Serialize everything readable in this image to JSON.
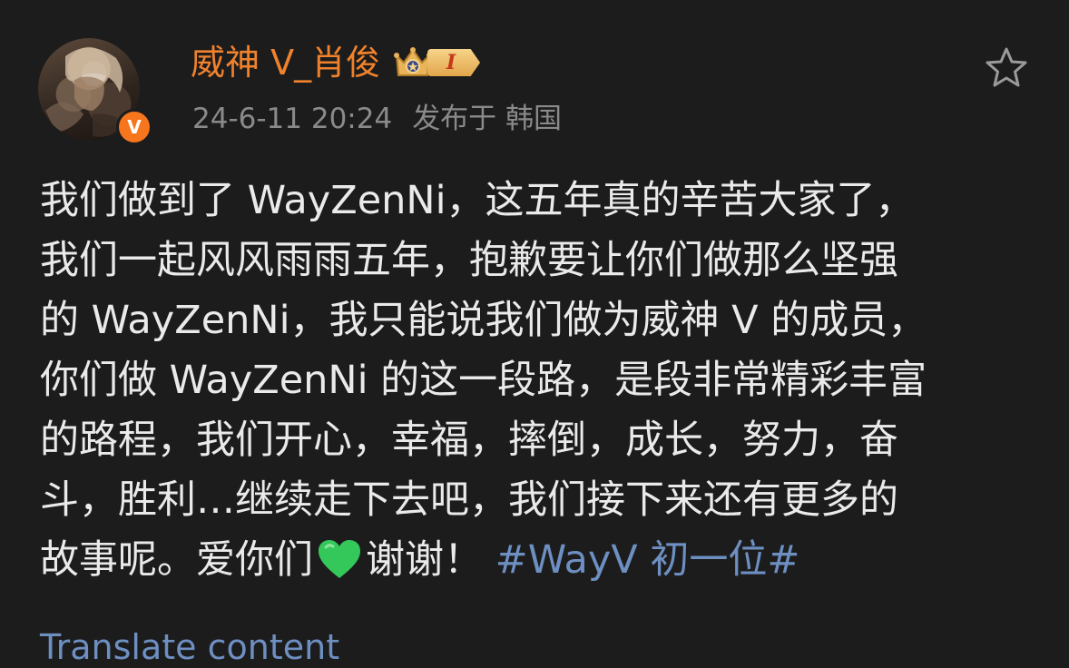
{
  "post": {
    "author": {
      "name": "威神 V_肖俊",
      "verified_badge": "V",
      "vip_level": "I",
      "avatar": "profile-photo"
    },
    "meta": {
      "timestamp": "24-6-11 20:24",
      "source": "发布于 韩国"
    },
    "favorite_icon": "star-outline-icon",
    "content": {
      "lines": [
        "我们做到了 WayZenNi，这五年真的辛苦大家了，",
        "我们一起风风雨雨五年，抱歉要让你们做那么坚强",
        "的 WayZenNi，我只能说我们做为威神 V 的成员，",
        "你们做 WayZenNi 的这一段路，是段非常精彩丰富",
        "的路程，我们开心，幸福，摔倒，成长，努力，奋",
        "斗，胜利…继续走下去吧，我们接下来还有更多的"
      ],
      "last_line_prefix": "故事呢。爱你们",
      "emoji": "green-heart-icon",
      "last_line_suffix": "谢谢！",
      "topic": "#WayV 初一位#"
    },
    "translate_label": "Translate content"
  },
  "colors": {
    "background": "#1c1c1c",
    "username": "#f0822d",
    "meta": "#8a8a8a",
    "body_text": "#eaeaea",
    "link": "#6d8fc2",
    "verified_badge": "#f7751c",
    "heart": "#34c759"
  }
}
